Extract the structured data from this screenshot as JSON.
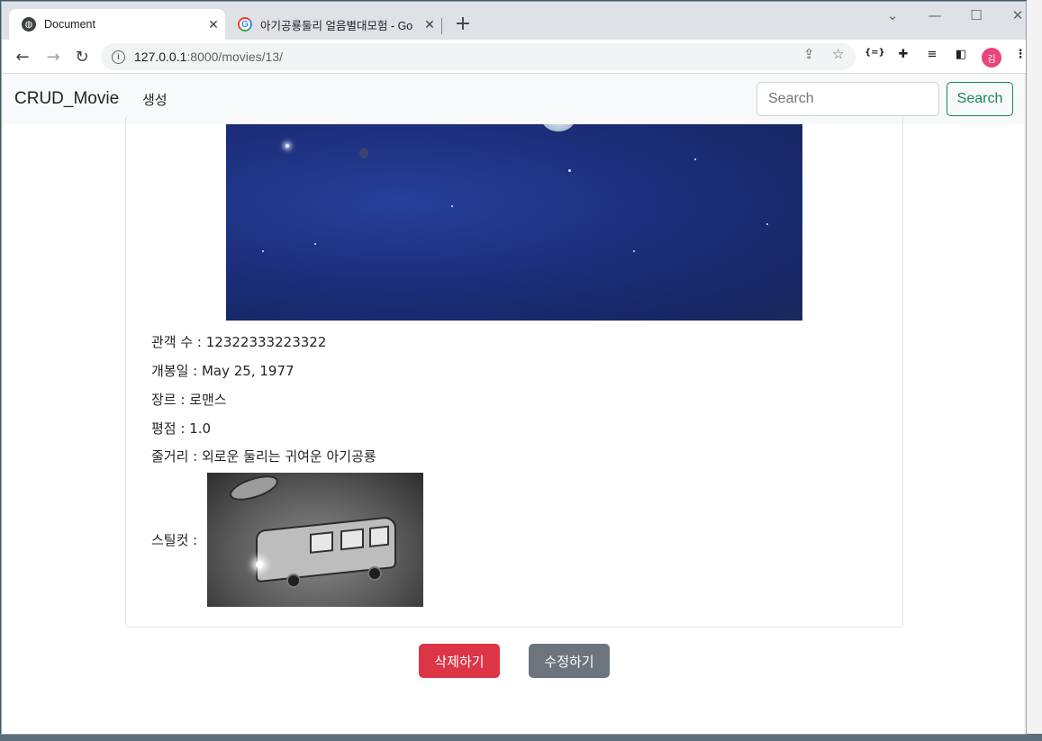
{
  "browser": {
    "tabs": [
      {
        "title": "Document",
        "active": true
      },
      {
        "title": "아기공룡둘리 얼음별대모험 - Go",
        "active": false
      }
    ],
    "url_host": "127.0.0.1",
    "url_path": ":8000/movies/13/",
    "profile_initial": "김",
    "ext_label": "{=}"
  },
  "navbar": {
    "brand": "CRUD_Movie",
    "create_link": "생성",
    "search_placeholder": "Search",
    "search_button": "Search"
  },
  "movie": {
    "audience": "관객 수 : 12322333223322",
    "release": "개봉일 : May 25, 1977",
    "genre": "장르 : 로맨스",
    "rating": "평점 : 1.0",
    "plot": "줄거리 : 외로운 둘리는 귀여운 아기공룡",
    "still_label": "스틸컷 :"
  },
  "actions": {
    "delete_label": "삭제하기",
    "edit_label": "수정하기"
  },
  "colors": {
    "delete": "#dc3545",
    "edit": "#6c757d",
    "search_outline": "#198754"
  }
}
